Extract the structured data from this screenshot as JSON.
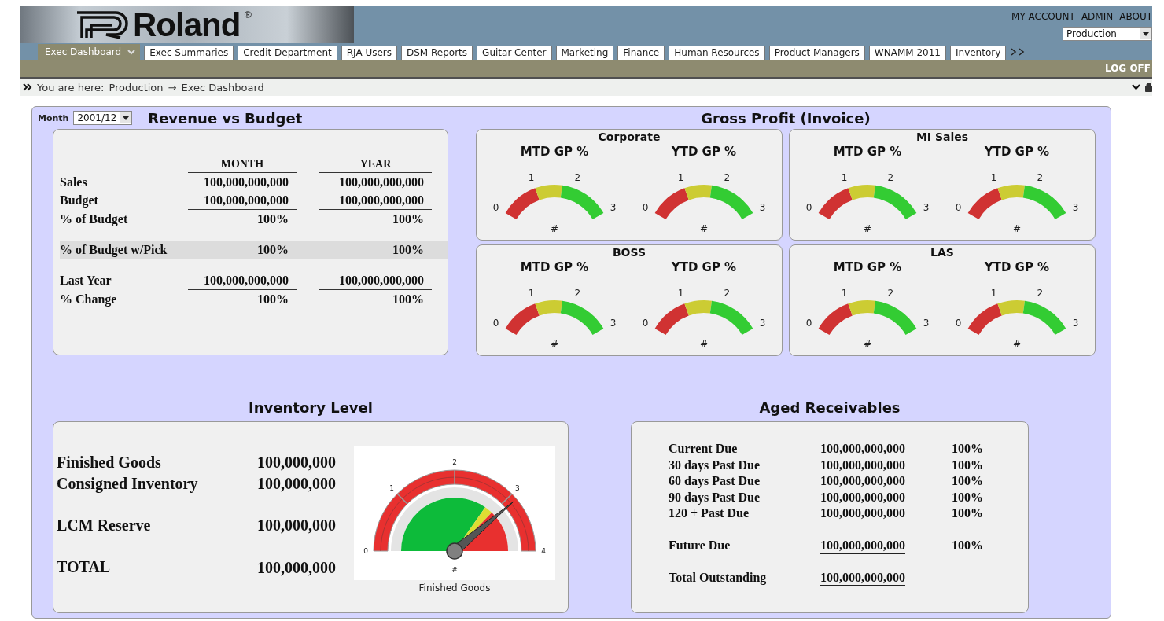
{
  "header": {
    "logo": {
      "name": "Roland",
      "mark": "®"
    },
    "links": [
      "MY ACCOUNT",
      "ADMIN",
      "ABOUT"
    ],
    "site_select": {
      "value": "Production"
    }
  },
  "tabs": [
    {
      "label": "Exec Dashboard",
      "selected": true
    },
    {
      "label": "Exec Summaries",
      "selected": false
    },
    {
      "label": "Credit Department",
      "selected": false
    },
    {
      "label": "RJA Users",
      "selected": false
    },
    {
      "label": "DSM Reports",
      "selected": false
    },
    {
      "label": "Guitar Center",
      "selected": false
    },
    {
      "label": "Marketing",
      "selected": false
    },
    {
      "label": "Finance",
      "selected": false
    },
    {
      "label": "Human Resources",
      "selected": false
    },
    {
      "label": "Product Managers",
      "selected": false
    },
    {
      "label": "WNAMM 2011",
      "selected": false
    },
    {
      "label": "Inventory",
      "selected": false
    }
  ],
  "log_off": "LOG OFF",
  "breadcrumb": {
    "prefix": "You are here:",
    "path": [
      "Production",
      "Exec Dashboard"
    ],
    "separator": "→"
  },
  "revenue": {
    "month_label": "Month",
    "month_value": "2001/12",
    "title": "Revenue vs Budget",
    "columns": [
      "MONTH",
      "YEAR"
    ],
    "groups": [
      [
        {
          "label": "Sales",
          "values": [
            "100,000,000,000",
            "100,000,000,000"
          ],
          "underline": false,
          "highlighted": false
        },
        {
          "label": "Budget",
          "values": [
            "100,000,000,000",
            "100,000,000,000"
          ],
          "underline": true,
          "highlighted": false
        },
        {
          "label": "% of Budget",
          "values": [
            "100%",
            "100%"
          ],
          "underline": false,
          "highlighted": false
        }
      ],
      [
        {
          "label": "% of Budget w/Pick",
          "values": [
            "100%",
            "100%"
          ],
          "underline": false,
          "highlighted": true
        }
      ],
      [
        {
          "label": "Last Year",
          "values": [
            "100,000,000,000",
            "100,000,000,000"
          ],
          "underline": true,
          "highlighted": false
        },
        {
          "label": "% Change",
          "values": [
            "100%",
            "100%"
          ],
          "underline": false,
          "highlighted": false
        }
      ]
    ]
  },
  "gross_profit": {
    "title": "Gross Profit (Invoice)",
    "panels": [
      {
        "name": "Corporate",
        "gauges": [
          {
            "title": "MTD GP %",
            "ticks": [
              "0",
              "1",
              "2",
              "3"
            ],
            "value_label": "#"
          },
          {
            "title": "YTD GP %",
            "ticks": [
              "0",
              "1",
              "2",
              "3"
            ],
            "value_label": "#"
          }
        ]
      },
      {
        "name": "MI Sales",
        "gauges": [
          {
            "title": "MTD GP %",
            "ticks": [
              "0",
              "1",
              "2",
              "3"
            ],
            "value_label": "#"
          },
          {
            "title": "YTD GP %",
            "ticks": [
              "0",
              "1",
              "2",
              "3"
            ],
            "value_label": "#"
          }
        ]
      },
      {
        "name": "BOSS",
        "gauges": [
          {
            "title": "MTD GP %",
            "ticks": [
              "0",
              "1",
              "2",
              "3"
            ],
            "value_label": "#"
          },
          {
            "title": "YTD GP %",
            "ticks": [
              "0",
              "1",
              "2",
              "3"
            ],
            "value_label": "#"
          }
        ]
      },
      {
        "name": "LAS",
        "gauges": [
          {
            "title": "MTD GP %",
            "ticks": [
              "0",
              "1",
              "2",
              "3"
            ],
            "value_label": "#"
          },
          {
            "title": "YTD GP %",
            "ticks": [
              "0",
              "1",
              "2",
              "3"
            ],
            "value_label": "#"
          }
        ]
      }
    ]
  },
  "inventory": {
    "title": "Inventory Level",
    "groups": [
      [
        {
          "label": "Finished Goods",
          "value": "100,000,000",
          "kind": "item"
        },
        {
          "label": "Consigned Inventory",
          "value": "100,000,000",
          "kind": "item"
        }
      ],
      [
        {
          "label": "LCM Reserve",
          "value": "100,000,000",
          "kind": "item"
        }
      ],
      [
        {
          "label": "TOTAL",
          "value": "100,000,000",
          "kind": "total"
        }
      ]
    ],
    "gauge": {
      "ticks": [
        "0",
        "1",
        "2",
        "3",
        "4"
      ],
      "value_label": "#",
      "caption": "Finished Goods"
    }
  },
  "aged_receivables": {
    "title": "Aged Receivables",
    "groups": [
      [
        {
          "label": "Current Due",
          "amount": "100,000,000,000",
          "percent": "100%",
          "underline": false
        },
        {
          "label": "30 days Past Due",
          "amount": "100,000,000,000",
          "percent": "100%",
          "underline": false
        },
        {
          "label": "60 days Past Due",
          "amount": "100,000,000,000",
          "percent": "100%",
          "underline": false
        },
        {
          "label": "90 days Past Due",
          "amount": "100,000,000,000",
          "percent": "100%",
          "underline": false
        },
        {
          "label": "120 + Past Due",
          "amount": "100,000,000,000",
          "percent": "100%",
          "underline": false
        }
      ],
      [
        {
          "label": "Future Due",
          "amount": "100,000,000,000",
          "percent": "100%",
          "underline": true
        }
      ],
      [
        {
          "label": "Total Outstanding",
          "amount": "100,000,000,000",
          "underline": true
        }
      ]
    ]
  }
}
